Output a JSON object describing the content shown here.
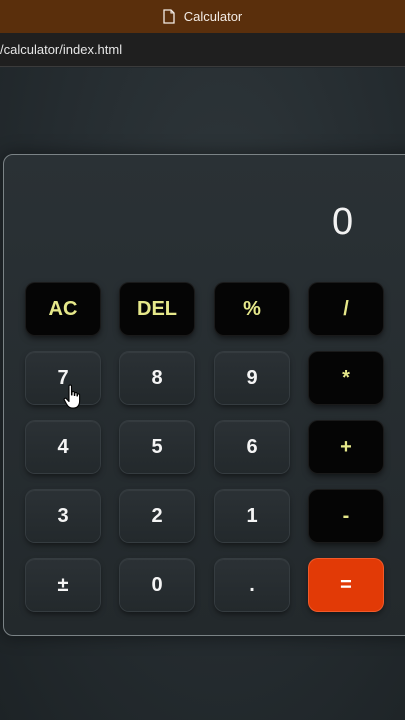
{
  "window": {
    "title": "Calculator",
    "address": "/calculator/index.html"
  },
  "calculator": {
    "display": "0",
    "buttons": {
      "ac": "AC",
      "del": "DEL",
      "percent": "%",
      "divide": "/",
      "seven": "7",
      "eight": "8",
      "nine": "9",
      "multiply": "*",
      "four": "4",
      "five": "5",
      "six": "6",
      "plus": "+",
      "three": "3",
      "two": "2",
      "one": "1",
      "minus": "-",
      "plus_minus": "±",
      "zero": "0",
      "dot": ".",
      "equals": "="
    }
  },
  "colors": {
    "title_bar": "#5a2f0c",
    "operator_text": "#e6e88a",
    "equals_bg": "#e23a06"
  }
}
